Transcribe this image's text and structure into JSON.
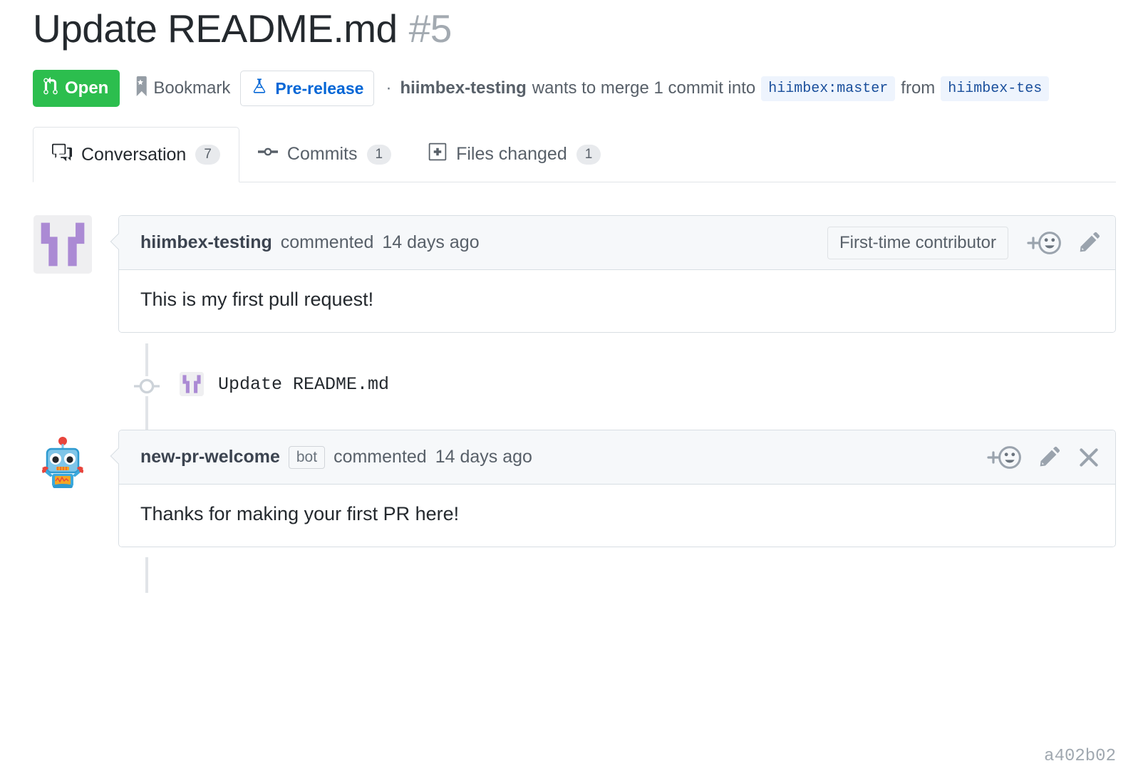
{
  "header": {
    "title": "Update README.md",
    "number": "#5",
    "state": "Open",
    "state_color": "#2cbe4e",
    "state_icon": "git-pull-request-icon",
    "bookmark_label": "Bookmark",
    "bookmark_icon": "bookmark-star-icon",
    "prerelease_label": "Pre-release",
    "prerelease_icon": "beaker-icon",
    "prerelease_color": "#0366d6",
    "separator": "·",
    "author": "hiimbex-testing",
    "merge_text": "wants to merge 1 commit into",
    "base_branch": "hiimbex:master",
    "from_text": "from",
    "head_branch": "hiimbex-tes"
  },
  "tabs": [
    {
      "label": "Conversation",
      "count": "7",
      "icon": "comment-discussion-icon",
      "active": true
    },
    {
      "label": "Commits",
      "count": "1",
      "icon": "git-commit-icon",
      "active": false
    },
    {
      "label": "Files changed",
      "count": "1",
      "icon": "file-diff-icon",
      "active": false
    }
  ],
  "timeline": {
    "comment_1": {
      "avatar": "identicon-avatar",
      "author": "hiimbex-testing",
      "action": "commented",
      "timestamp": "14 days ago",
      "badge": "First-time contributor",
      "reaction_icon": "add-reaction-icon",
      "edit_icon": "pencil-icon",
      "body": "This is my first pull request!"
    },
    "commit": {
      "avatar": "identicon-avatar",
      "message": "Update README.md",
      "sha": "a402b02",
      "dot_icon": "git-commit-dot-icon"
    },
    "comment_2": {
      "avatar": "robot-avatar",
      "author": "new-pr-welcome",
      "bot_tag": "bot",
      "action": "commented",
      "timestamp": "14 days ago",
      "reaction_icon": "add-reaction-icon",
      "edit_icon": "pencil-icon",
      "close_icon": "close-icon",
      "body": "Thanks for making your first PR here!"
    }
  }
}
